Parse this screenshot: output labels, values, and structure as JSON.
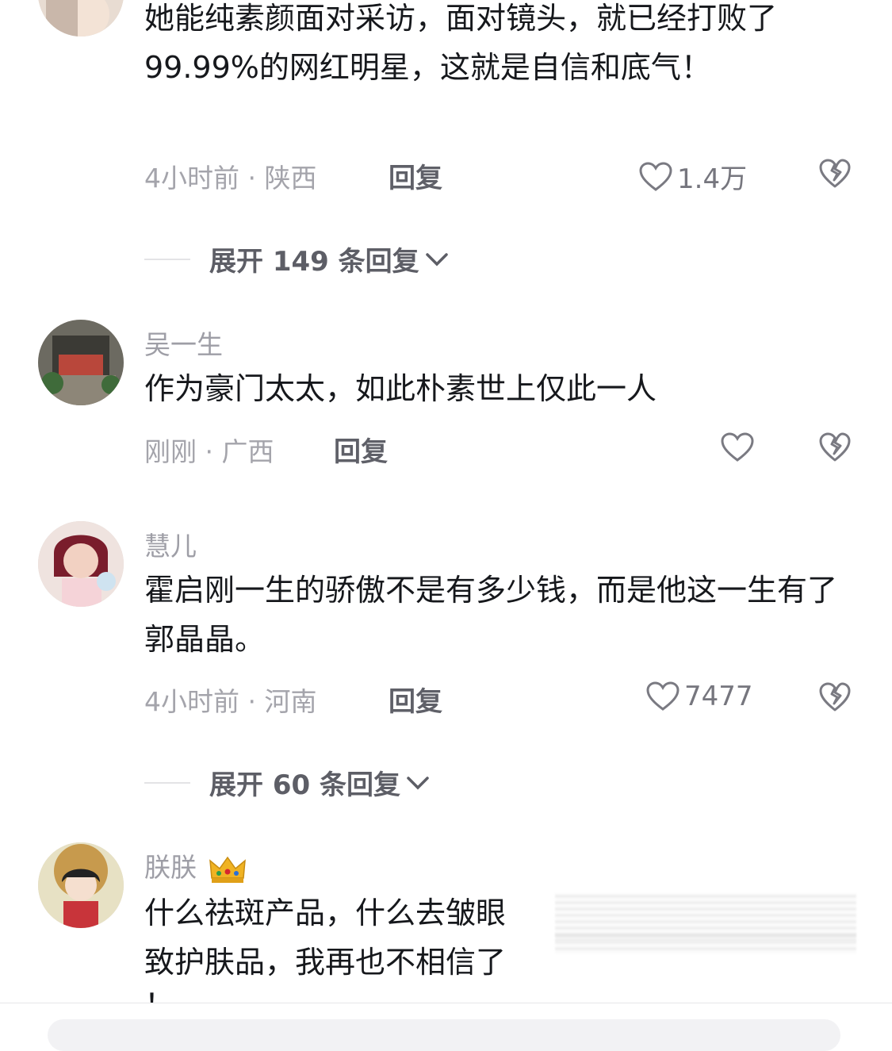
{
  "comments": [
    {
      "text": "她能纯素颜面对采访，面对镜头，就已经打败了 99.99%的网红明星，这就是自信和底气！",
      "time_location": "4小时前 · 陕西",
      "reply_label": "回复",
      "likes": "1.4万",
      "expand_label": "展开 149 条回复"
    },
    {
      "name": "吴一生",
      "text": "作为豪门太太，如此朴素世上仅此一人",
      "time_location": "刚刚 · 广西",
      "reply_label": "回复",
      "likes": ""
    },
    {
      "name": "慧儿",
      "text": "霍启刚一生的骄傲不是有多少钱，而是他这一生有了郭晶晶。",
      "time_location": "4小时前 · 河南",
      "reply_label": "回复",
      "likes": "7477",
      "expand_label": "展开 60 条回复"
    },
    {
      "name": "朕朕",
      "text": "什么祛斑产品，什么去皱眼",
      "text_line2": "致护肤品，我再也不相信了",
      "text_line3": "！"
    }
  ],
  "icons": {
    "like": "heart-outline-icon",
    "dislike": "broken-heart-icon",
    "expand": "chevron-down-icon",
    "badge": "crown-icon"
  }
}
